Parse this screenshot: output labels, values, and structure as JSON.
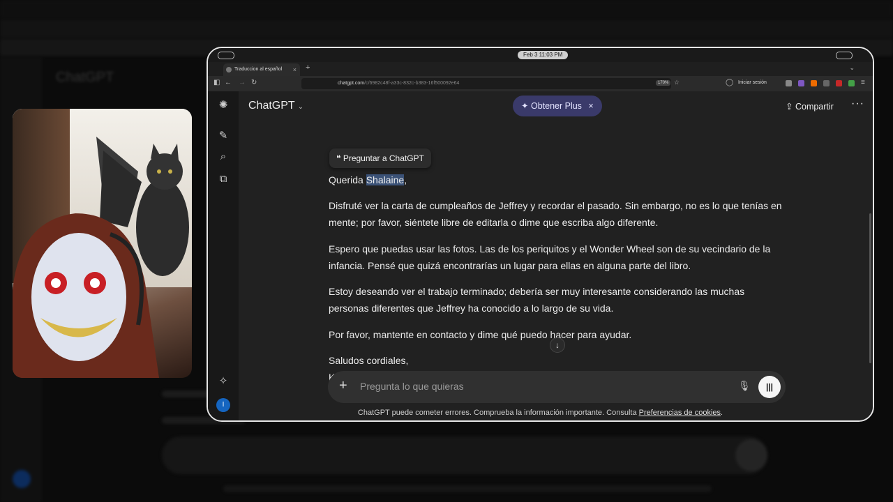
{
  "browser": {
    "clock": "Feb 3  11:03 PM",
    "tab_title": "Traduccion al español",
    "new_tab": "+",
    "url_domain": "chatgpt.com",
    "url_path": "/c/6982c48f-a33c-832c-b383-16f500092e64",
    "zoom": "170%",
    "signin": "Iniciar sesión"
  },
  "app": {
    "title": "ChatGPT",
    "plus_label": "Obtener Plus",
    "share_label": "Compartir",
    "user_initial": "I"
  },
  "selection": {
    "quote_label": "Preguntar a ChatGPT"
  },
  "message": {
    "greeting_prefix": "Querida ",
    "greeting_name": "Shalaine",
    "greeting_suffix": ",",
    "paragraphs": [
      "Disfruté ver la carta de cumpleaños de Jeffrey y recordar el pasado. Sin embargo, no es lo que tenías en mente; por favor, siéntete libre de editarla o dime que escriba algo diferente.",
      "Espero que puedas usar las fotos. Las de los periquitos y el Wonder Wheel son de su vecindario de la infancia. Pensé que quizá encontrarías un lugar para ellas en alguna parte del libro.",
      "Estoy deseando ver el trabajo terminado; debería ser muy interesante considerando las muchas personas diferentes que Jeffrey ha conocido a lo largo de su vida.",
      "Por favor, mantente en contacto y dime qué puedo hacer para ayudar."
    ],
    "closing": "Saludos cordiales,",
    "signature_partial": "K"
  },
  "composer": {
    "placeholder": "Pregunta lo que quieras"
  },
  "footer": {
    "text": "ChatGPT puede cometer errores. Comprueba la información importante. Consulta ",
    "link": "Preferencias de cookies",
    "end": "."
  },
  "background": {
    "title": "ChatGPT"
  }
}
